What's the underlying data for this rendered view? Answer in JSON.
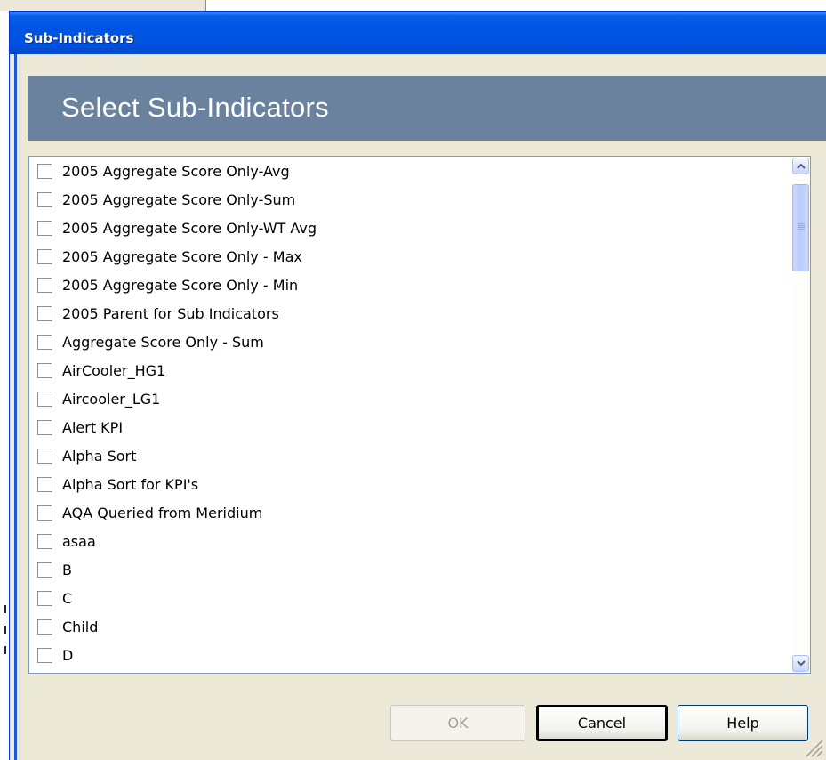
{
  "window": {
    "title": "Sub-Indicators"
  },
  "header": {
    "title": "Select Sub-Indicators"
  },
  "sub_indicators": [
    {
      "label": "2005 Aggregate Score Only-Avg",
      "checked": false
    },
    {
      "label": "2005 Aggregate Score Only-Sum",
      "checked": false
    },
    {
      "label": "2005 Aggregate Score Only-WT Avg",
      "checked": false
    },
    {
      "label": "2005 Aggregate Score Only - Max",
      "checked": false
    },
    {
      "label": "2005 Aggregate Score Only - Min",
      "checked": false
    },
    {
      "label": "2005 Parent for Sub Indicators",
      "checked": false
    },
    {
      "label": "Aggregate Score Only - Sum",
      "checked": false
    },
    {
      "label": "AirCooler_HG1",
      "checked": false
    },
    {
      "label": "Aircooler_LG1",
      "checked": false
    },
    {
      "label": "Alert KPI",
      "checked": false
    },
    {
      "label": "Alpha Sort",
      "checked": false
    },
    {
      "label": "Alpha Sort for KPI's",
      "checked": false
    },
    {
      "label": "AQA Queried from Meridium",
      "checked": false
    },
    {
      "label": "asaa",
      "checked": false
    },
    {
      "label": "B",
      "checked": false
    },
    {
      "label": "C",
      "checked": false
    },
    {
      "label": "Child",
      "checked": false
    },
    {
      "label": "D",
      "checked": false
    }
  ],
  "buttons": {
    "ok": {
      "label": "OK",
      "enabled": false
    },
    "cancel": {
      "label": "Cancel",
      "enabled": true,
      "default": true
    },
    "help": {
      "label": "Help",
      "enabled": true
    }
  },
  "icons": {
    "scroll_up": "chevron-up-icon",
    "scroll_down": "chevron-down-icon",
    "resize": "resize-grip-icon"
  },
  "colors": {
    "title_bar": "#0054e3",
    "header_band": "#6b829f",
    "dialog_face": "#ece9d8",
    "scroll_accent": "#4d6185"
  }
}
